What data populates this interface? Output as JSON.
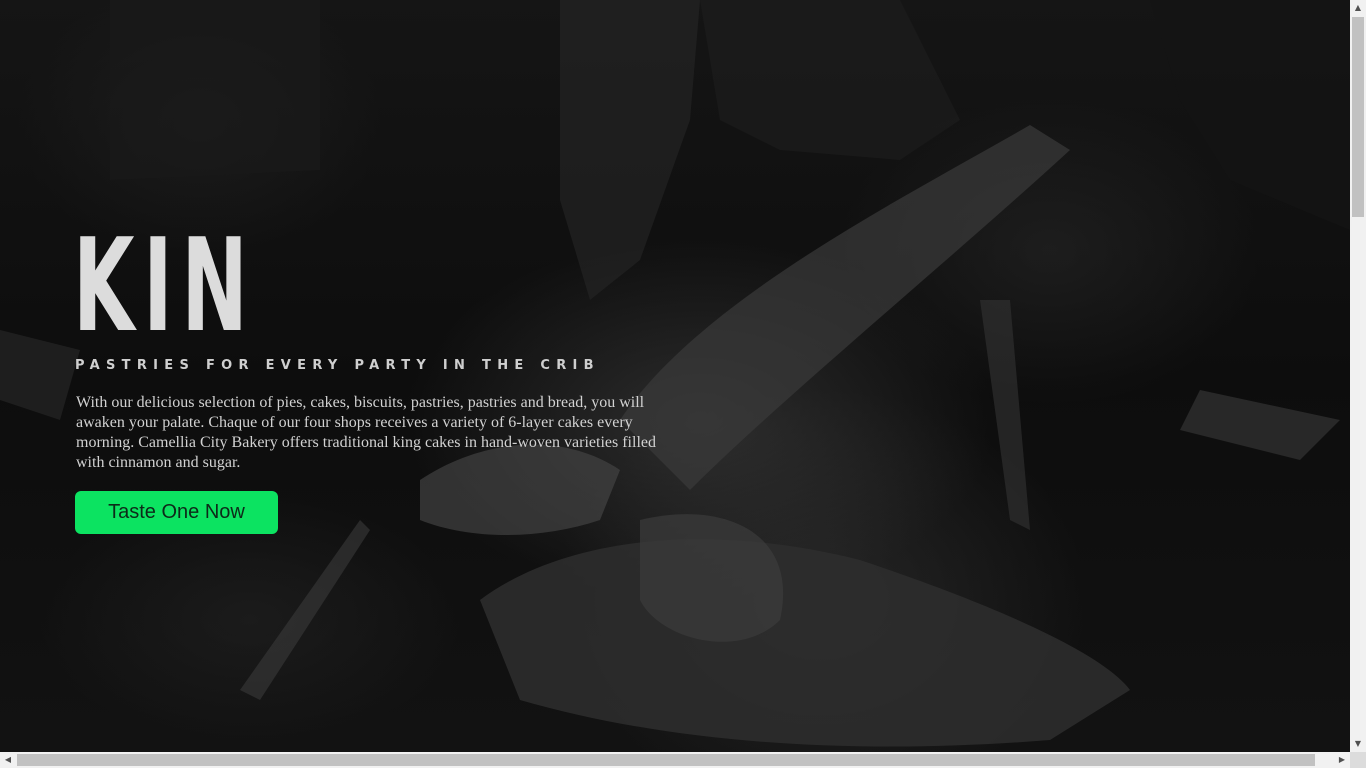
{
  "hero": {
    "brand_title": "KIN",
    "tagline": "PASTRIES FOR EVERY PARTY IN THE CRIB",
    "description": "With our delicious selection of pies, cakes, biscuits, pastries, pastries and bread, you will awaken your palate. Chaque of our four shops receives a variety of 6-layer cakes every morning. Camellia City Bakery offers traditional king cakes in hand-woven varieties filled with cinnamon and sugar.",
    "cta_label": "Taste One Now"
  },
  "scrollbars": {
    "up_arrow": "▲",
    "down_arrow": "▼",
    "left_arrow": "◀",
    "right_arrow": "▶"
  },
  "colors": {
    "accent": "#0ce361",
    "title_text": "#dcdcdc",
    "background": "#0a0a0a"
  },
  "icons": {
    "scroll_up": "triangle-up-icon",
    "scroll_down": "triangle-down-icon",
    "scroll_left": "triangle-left-icon",
    "scroll_right": "triangle-right-icon"
  }
}
